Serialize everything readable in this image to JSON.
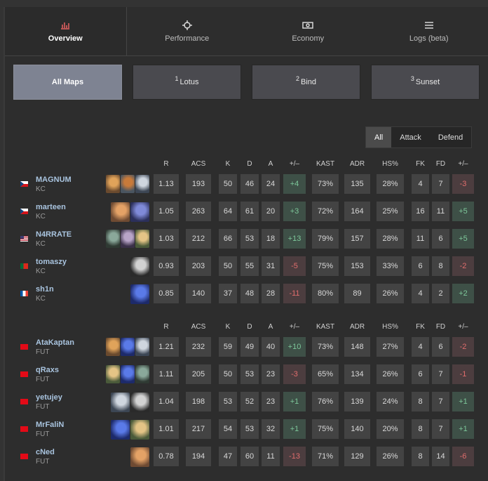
{
  "nav": {
    "tabs": [
      {
        "label": "Overview",
        "icon": "bar-chart-icon",
        "active": true
      },
      {
        "label": "Performance",
        "icon": "crosshair-icon",
        "active": false
      },
      {
        "label": "Economy",
        "icon": "money-icon",
        "active": false
      },
      {
        "label": "Logs (beta)",
        "icon": "list-icon",
        "active": false
      }
    ]
  },
  "maps": [
    {
      "num": "",
      "label": "All Maps",
      "active": true
    },
    {
      "num": "1",
      "label": "Lotus",
      "active": false
    },
    {
      "num": "2",
      "label": "Bind",
      "active": false
    },
    {
      "num": "3",
      "label": "Sunset",
      "active": false
    }
  ],
  "side_filter": [
    "All",
    "Attack",
    "Defend"
  ],
  "columns": [
    "R",
    "ACS",
    "K",
    "D",
    "A",
    "+/–",
    "KAST",
    "ADR",
    "HS%",
    "FK",
    "FD",
    "+/–"
  ],
  "colors": {
    "positive": "#7dc79a",
    "negative": "#e06d6d",
    "name": "#a9c4df"
  },
  "teams": [
    {
      "players": [
        {
          "name": "MAGNUM",
          "team": "KC",
          "flag": "cz",
          "agents": [
            "breach-agent-icon",
            "kayo-agent-icon",
            "sova-agent-icon"
          ],
          "stats": [
            "1.13",
            "193",
            "50",
            "46",
            "24",
            "+4",
            "73%",
            "135",
            "28%",
            "4",
            "7",
            "-3"
          ]
        },
        {
          "name": "marteen",
          "team": "KC",
          "flag": "cz",
          "agents": [
            "raze-agent-icon",
            "omen-agent-icon"
          ],
          "stats": [
            "1.05",
            "263",
            "64",
            "61",
            "20",
            "+3",
            "72%",
            "164",
            "25%",
            "16",
            "11",
            "+5"
          ]
        },
        {
          "name": "N4RRATE",
          "team": "KC",
          "flag": "us",
          "agents": [
            "viper-agent-icon",
            "fade-agent-icon",
            "skye-agent-icon"
          ],
          "stats": [
            "1.03",
            "212",
            "66",
            "53",
            "18",
            "+13",
            "79%",
            "157",
            "28%",
            "11",
            "6",
            "+5"
          ]
        },
        {
          "name": "tomaszy",
          "team": "KC",
          "flag": "pt",
          "agents": [
            "cypher-agent-icon"
          ],
          "stats": [
            "0.93",
            "203",
            "50",
            "55",
            "31",
            "-5",
            "75%",
            "153",
            "33%",
            "6",
            "8",
            "-2"
          ]
        },
        {
          "name": "sh1n",
          "team": "KC",
          "flag": "fr",
          "agents": [
            "neon-agent-icon"
          ],
          "stats": [
            "0.85",
            "140",
            "37",
            "48",
            "28",
            "-11",
            "80%",
            "89",
            "26%",
            "4",
            "2",
            "+2"
          ]
        }
      ]
    },
    {
      "players": [
        {
          "name": "AtaKaptan",
          "team": "FUT",
          "flag": "tr",
          "agents": [
            "breach-agent-icon",
            "neon-agent-icon",
            "sova-agent-icon"
          ],
          "stats": [
            "1.21",
            "232",
            "59",
            "49",
            "40",
            "+10",
            "73%",
            "148",
            "27%",
            "4",
            "6",
            "-2"
          ]
        },
        {
          "name": "qRaxs",
          "team": "FUT",
          "flag": "tr",
          "agents": [
            "skye-agent-icon",
            "neon-agent-icon",
            "viper-agent-icon"
          ],
          "stats": [
            "1.11",
            "205",
            "50",
            "53",
            "23",
            "-3",
            "65%",
            "134",
            "26%",
            "6",
            "7",
            "-1"
          ]
        },
        {
          "name": "yetujey",
          "team": "FUT",
          "flag": "tr",
          "agents": [
            "sova-agent-icon",
            "cypher-agent-icon"
          ],
          "stats": [
            "1.04",
            "198",
            "53",
            "52",
            "23",
            "+1",
            "76%",
            "139",
            "24%",
            "8",
            "7",
            "+1"
          ]
        },
        {
          "name": "MrFaliN",
          "team": "FUT",
          "flag": "tr",
          "agents": [
            "neon-agent-icon",
            "skye-agent-icon"
          ],
          "stats": [
            "1.01",
            "217",
            "54",
            "53",
            "32",
            "+1",
            "75%",
            "140",
            "20%",
            "8",
            "7",
            "+1"
          ]
        },
        {
          "name": "cNed",
          "team": "FUT",
          "flag": "tr",
          "agents": [
            "raze-agent-icon"
          ],
          "stats": [
            "0.78",
            "194",
            "47",
            "60",
            "11",
            "-13",
            "71%",
            "129",
            "26%",
            "8",
            "14",
            "-6"
          ]
        }
      ]
    }
  ]
}
